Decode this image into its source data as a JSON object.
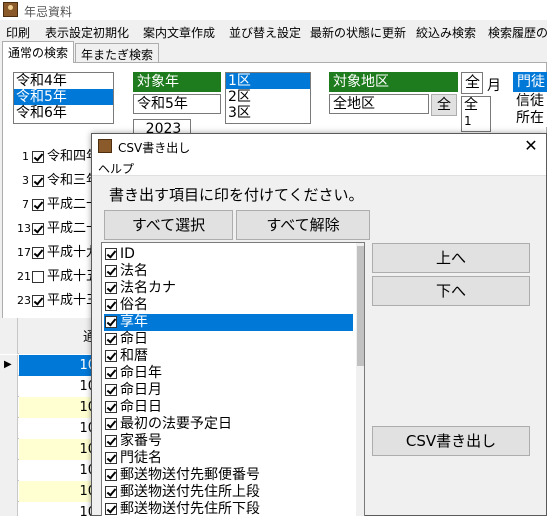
{
  "app": {
    "title": "年忌資料"
  },
  "menu": [
    "印刷",
    "表示設定初期化",
    "案内文章作成",
    "並び替え設定",
    "最新の状態に更新",
    "絞込み検索",
    "検索履歴の"
  ],
  "tabs": [
    "通常の検索",
    "年またぎ検索"
  ],
  "era_list": {
    "items": [
      "令和4年",
      "令和5年",
      "令和6年"
    ],
    "selected": "令和5年"
  },
  "target_year": {
    "header": "対象年",
    "value": "令和5年",
    "western": "2023"
  },
  "district_list": {
    "items": [
      "1区",
      "2区",
      "3区"
    ],
    "selected": "1区"
  },
  "target_area": {
    "header": "対象地区",
    "value": "全地区",
    "all_button": "全"
  },
  "month": {
    "all_label": "全",
    "unit": "月",
    "list": [
      "全",
      "1"
    ]
  },
  "member": {
    "header": "門徒",
    "lines": [
      "信徒",
      "所在"
    ]
  },
  "year_checks": [
    {
      "num": "1",
      "label": "令和四年",
      "checked": true
    },
    {
      "num": "3",
      "label": "令和三年",
      "checked": true
    },
    {
      "num": "7",
      "label": "平成二十",
      "checked": true
    },
    {
      "num": "13",
      "label": "平成二十",
      "checked": true
    },
    {
      "num": "17",
      "label": "平成十九",
      "checked": true
    },
    {
      "num": "21",
      "label": "平成十五",
      "checked": false
    },
    {
      "num": "23",
      "label": "平成十三",
      "checked": true
    }
  ],
  "right_partial": [
    "月",
    "月",
    "定",
    "応",
    "範",
    "秘"
  ],
  "grid": {
    "header": "通",
    "rows": [
      "10",
      "10",
      "10",
      "10",
      "10",
      "10",
      "10",
      "10"
    ]
  },
  "dialog": {
    "title": "CSV書き出し",
    "close": "✕",
    "help_menu": "ヘルプ",
    "instruction": "書き出す項目に印を付けてください。",
    "select_all": "すべて選択",
    "deselect_all": "すべて解除",
    "up": "上へ",
    "down": "下へ",
    "export": "CSV書き出し",
    "items": [
      {
        "label": "ID",
        "checked": true
      },
      {
        "label": "法名",
        "checked": true
      },
      {
        "label": "法名カナ",
        "checked": true
      },
      {
        "label": "俗名",
        "checked": true
      },
      {
        "label": "享年",
        "checked": true,
        "selected": true
      },
      {
        "label": "命日",
        "checked": true
      },
      {
        "label": "和暦",
        "checked": true
      },
      {
        "label": "命日年",
        "checked": true
      },
      {
        "label": "命日月",
        "checked": true
      },
      {
        "label": "命日日",
        "checked": true
      },
      {
        "label": "最初の法要予定日",
        "checked": true
      },
      {
        "label": "家番号",
        "checked": true
      },
      {
        "label": "門徒名",
        "checked": true
      },
      {
        "label": "郵送物送付先郵便番号",
        "checked": true
      },
      {
        "label": "郵送物送付先住所上段",
        "checked": true
      },
      {
        "label": "郵送物送付先住所下段",
        "checked": true
      }
    ]
  },
  "colors": {
    "accent": "#0078d7",
    "header_green": "#1e7b1e",
    "row_yellow": "#ffffd2"
  }
}
